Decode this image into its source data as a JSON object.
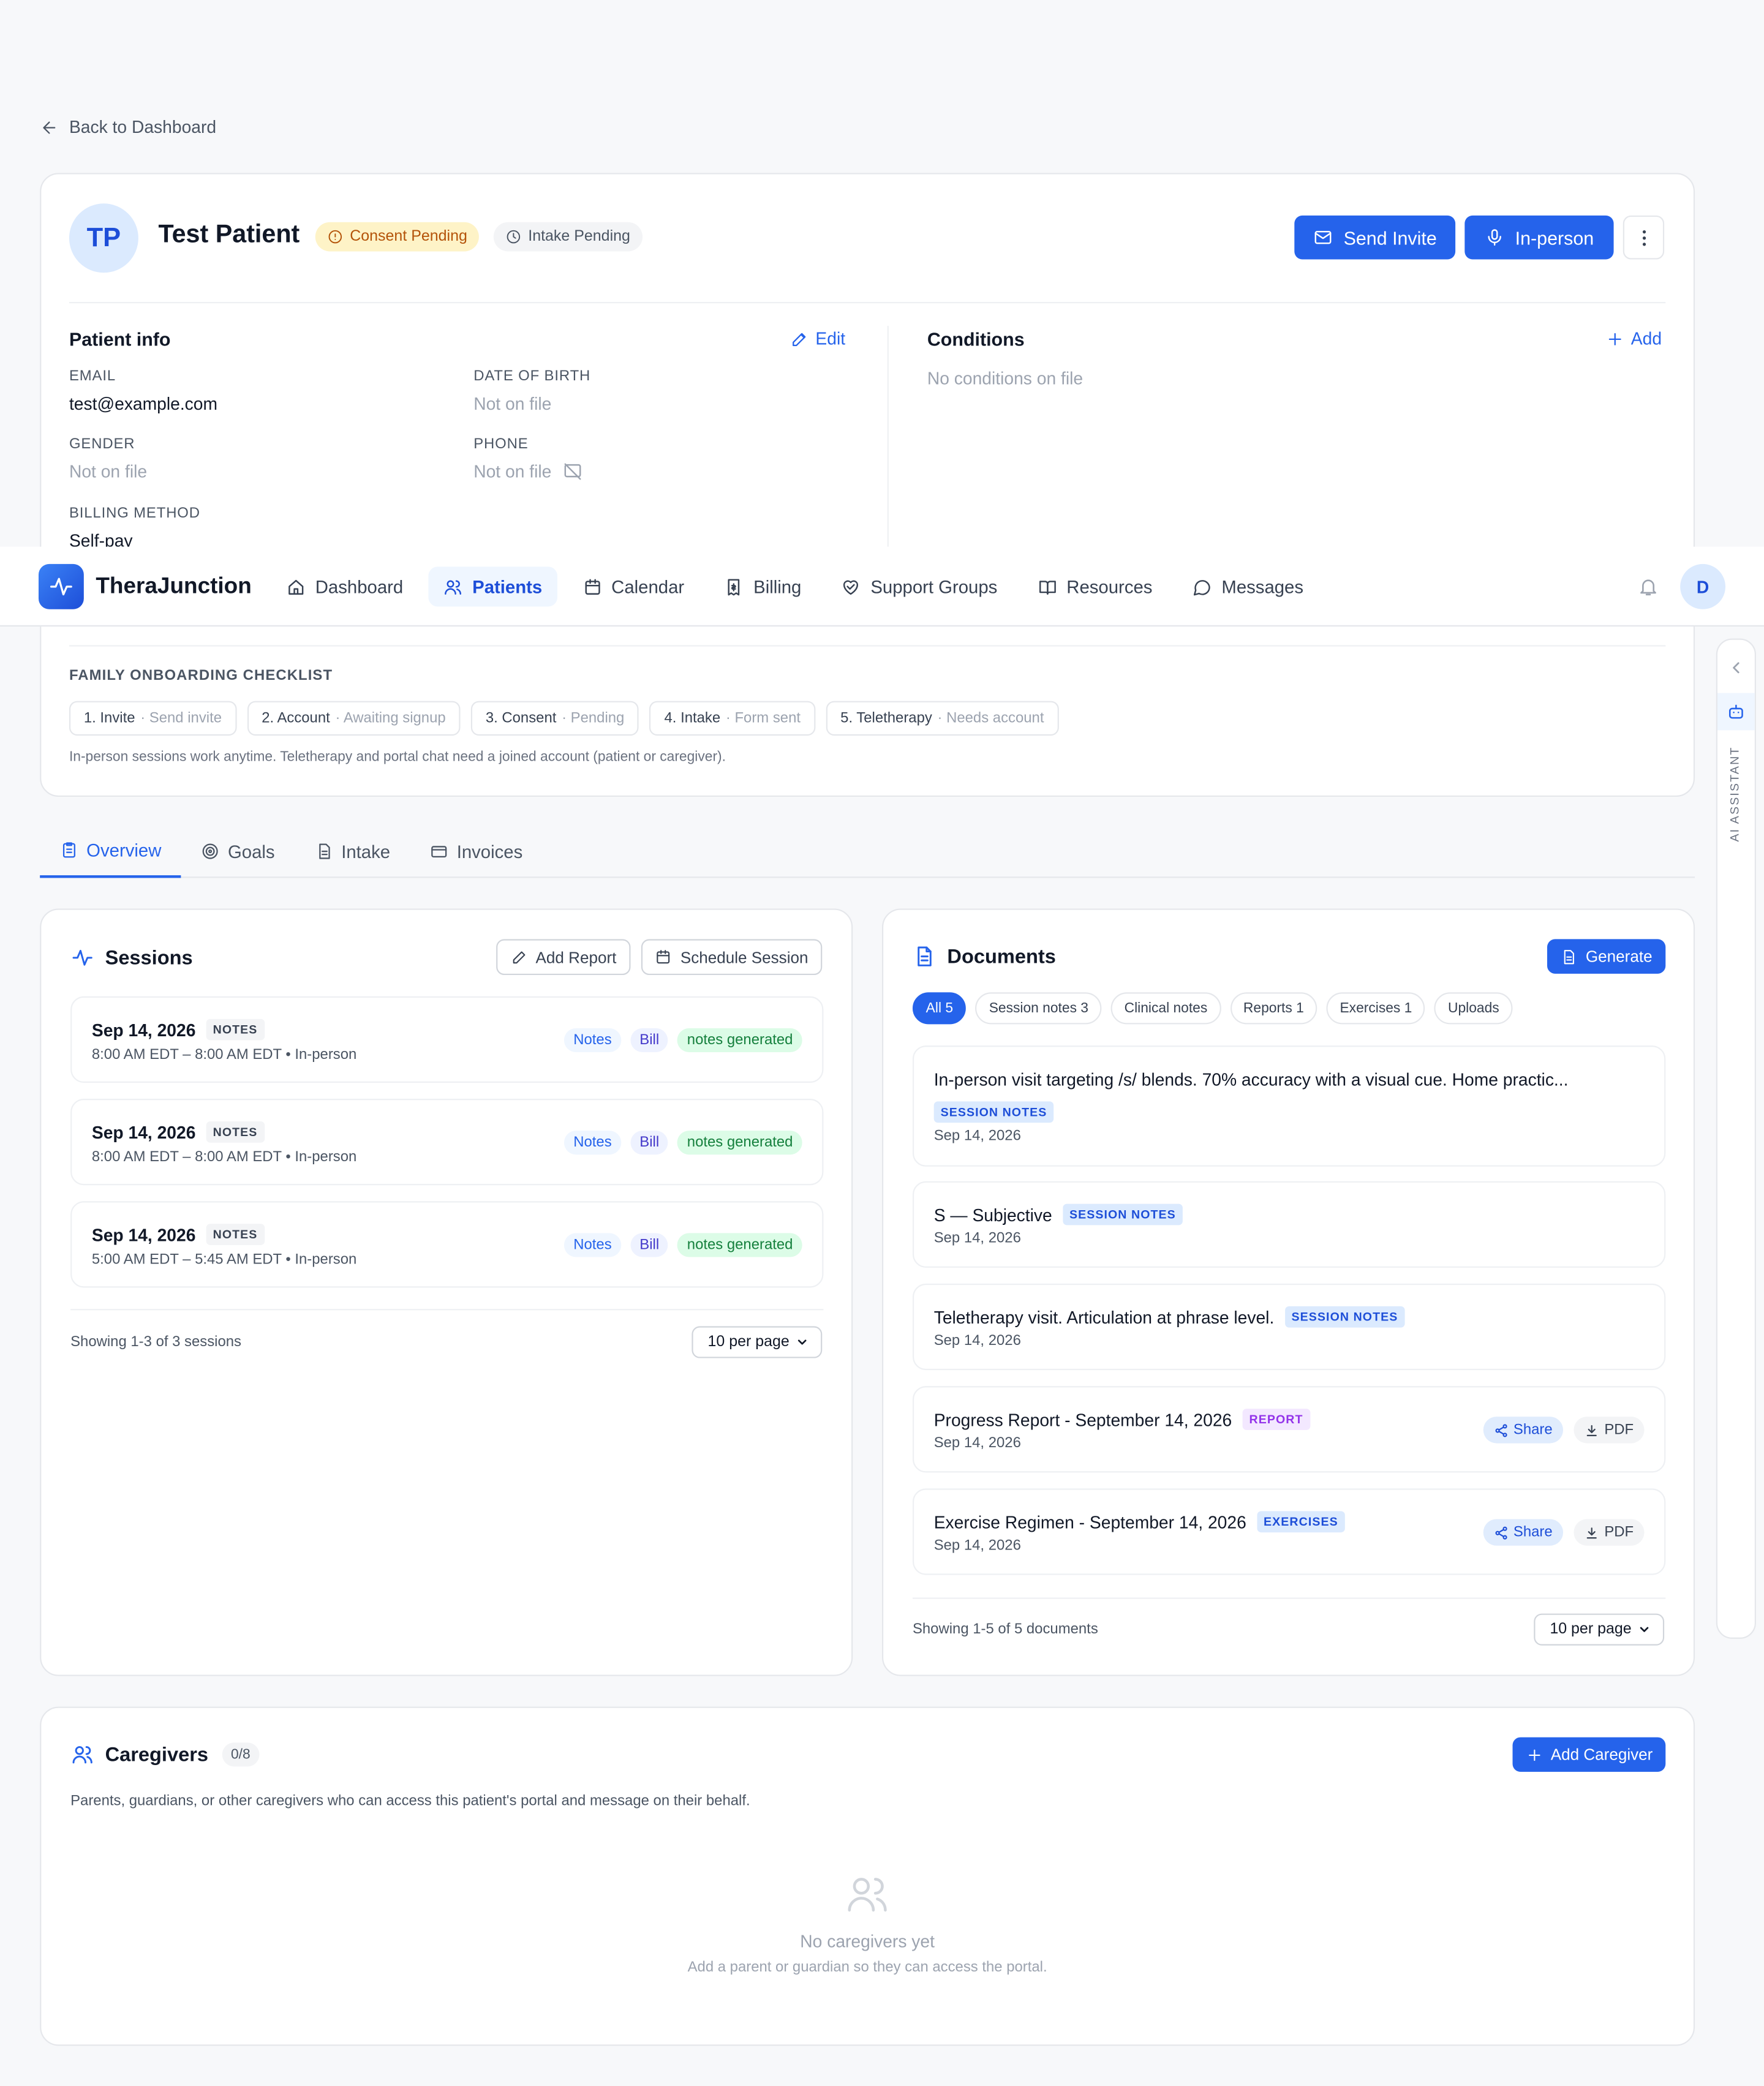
{
  "back": {
    "label": "Back to Dashboard"
  },
  "patient": {
    "initials": "TP",
    "name": "Test Patient",
    "consent_status": "Consent Pending",
    "intake_status": "Intake Pending",
    "send_invite_label": "Send Invite",
    "in_person_label": "In-person"
  },
  "patient_info": {
    "title": "Patient info",
    "edit_label": "Edit",
    "email_label": "EMAIL",
    "email_value": "test@example.com",
    "dob_label": "DATE OF BIRTH",
    "dob_value": "Not on file",
    "gender_label": "GENDER",
    "gender_value": "Not on file",
    "phone_label": "PHONE",
    "phone_value": "Not on file",
    "billing_label": "BILLING METHOD",
    "billing_value": "Self-pay"
  },
  "conditions": {
    "title": "Conditions",
    "add_label": "Add",
    "empty": "No conditions on file"
  },
  "nav": {
    "brand": "TheraJunction",
    "items": [
      {
        "label": "Dashboard",
        "icon": "home-icon"
      },
      {
        "label": "Patients",
        "icon": "users-icon"
      },
      {
        "label": "Calendar",
        "icon": "calendar-icon"
      },
      {
        "label": "Billing",
        "icon": "receipt-icon"
      },
      {
        "label": "Support Groups",
        "icon": "heart-handshake-icon"
      },
      {
        "label": "Resources",
        "icon": "book-icon"
      },
      {
        "label": "Messages",
        "icon": "message-circle-icon"
      }
    ],
    "active": "Patients",
    "user_initial": "D"
  },
  "checklist": {
    "title": "FAMILY ONBOARDING CHECKLIST",
    "steps": [
      {
        "label": "1. Invite",
        "status": "· Send invite"
      },
      {
        "label": "2. Account",
        "status": "· Awaiting signup"
      },
      {
        "label": "3. Consent",
        "status": "· Pending"
      },
      {
        "label": "4. Intake",
        "status": "· Form sent"
      },
      {
        "label": "5. Teletherapy",
        "status": "· Needs account"
      }
    ],
    "note": "In-person sessions work anytime. Teletherapy and portal chat need a joined account (patient or caregiver)."
  },
  "tabs": [
    {
      "label": "Overview"
    },
    {
      "label": "Goals"
    },
    {
      "label": "Intake"
    },
    {
      "label": "Invoices"
    }
  ],
  "sessions": {
    "title": "Sessions",
    "add_report_label": "Add Report",
    "schedule_label": "Schedule Session",
    "items": [
      {
        "date": "Sep 14, 2026",
        "tag": "NOTES",
        "time": "8:00 AM EDT – 8:00 AM EDT • In-person",
        "notes": "Notes",
        "bill": "Bill",
        "status": "notes generated"
      },
      {
        "date": "Sep 14, 2026",
        "tag": "NOTES",
        "time": "8:00 AM EDT – 8:00 AM EDT • In-person",
        "notes": "Notes",
        "bill": "Bill",
        "status": "notes generated"
      },
      {
        "date": "Sep 14, 2026",
        "tag": "NOTES",
        "time": "5:00 AM EDT – 5:45 AM EDT • In-person",
        "notes": "Notes",
        "bill": "Bill",
        "status": "notes generated"
      }
    ],
    "footer": "Showing 1-3 of 3 sessions",
    "per_page": "10 per page"
  },
  "documents": {
    "title": "Documents",
    "generate_label": "Generate",
    "filters": [
      "All 5",
      "Session notes 3",
      "Clinical notes",
      "Reports 1",
      "Exercises 1",
      "Uploads"
    ],
    "active_filter": "All 5",
    "items": [
      {
        "title": "In-person visit targeting /s/ blends. 70% accuracy with a visual cue. Home practic...",
        "tag": "SESSION NOTES",
        "date": "Sep 14, 2026"
      },
      {
        "title": "S — Subjective",
        "tag": "SESSION NOTES",
        "date": "Sep 14, 2026"
      },
      {
        "title": "Teletherapy visit. Articulation at phrase level.",
        "tag": "SESSION NOTES",
        "date": "Sep 14, 2026"
      },
      {
        "title": "Progress Report - September 14, 2026",
        "tag": "REPORT",
        "date": "Sep 14, 2026",
        "share": "Share",
        "pdf": "PDF"
      },
      {
        "title": "Exercise Regimen - September 14, 2026",
        "tag": "EXERCISES",
        "date": "Sep 14, 2026",
        "share": "Share",
        "pdf": "PDF"
      }
    ],
    "footer": "Showing 1-5 of 5 documents",
    "per_page": "10 per page"
  },
  "caregivers": {
    "title": "Caregivers",
    "count": "0/8",
    "add_label": "Add Caregiver",
    "description": "Parents, guardians, or other caregivers who can access this patient's portal and message on their behalf.",
    "empty_title": "No caregivers yet",
    "empty_sub": "Add a parent or guardian so they can access the portal."
  },
  "assistant": {
    "label": "AI ASSISTANT"
  },
  "colors": {
    "primary": "#2563eb",
    "amber": "#b45309",
    "green": "#15803d"
  }
}
